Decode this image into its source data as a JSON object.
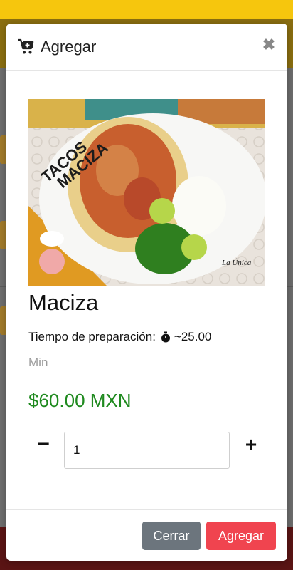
{
  "modal": {
    "title": "Agregar",
    "close_symbol": "✖",
    "product": {
      "image_alt": "Tacos Maciza",
      "image_text_main": "TACOS",
      "image_text_sub": "MACIZA",
      "image_brand": "La Única",
      "name": "Maciza",
      "prep_label": "Tiempo de preparación:",
      "prep_value": "~25.00",
      "prep_unit": "Min",
      "price": "$60.00 MXN"
    },
    "quantity": {
      "minus_label": "−",
      "value": "1",
      "plus_label": "+"
    },
    "footer": {
      "cancel_label": "Cerrar",
      "add_label": "Agregar"
    }
  },
  "icons": {
    "header": "cart-plus-icon",
    "close": "close-icon",
    "timer": "stopwatch-icon"
  },
  "colors": {
    "price": "#1f8a1f",
    "cancel_button": "#6c757d",
    "add_button": "#f0444f",
    "top_bar": "#f6c60d"
  }
}
